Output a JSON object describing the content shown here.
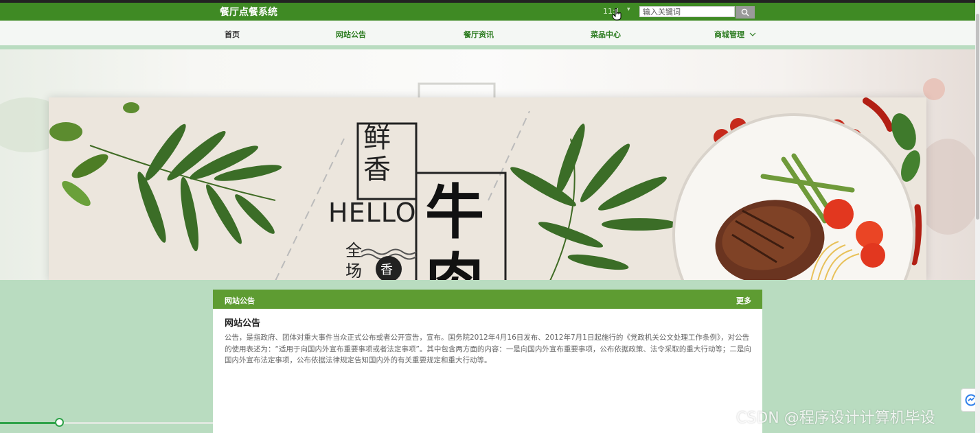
{
  "header": {
    "site_title": "餐厅点餐系统",
    "user_name": "11:1",
    "search_placeholder": "输入关键词"
  },
  "nav": {
    "items": [
      {
        "label": "首页"
      },
      {
        "label": "网站公告"
      },
      {
        "label": "餐厅资讯"
      },
      {
        "label": "菜品中心"
      },
      {
        "label": "商城管理"
      }
    ]
  },
  "banner": {
    "title_vertical": [
      "鲜",
      "香"
    ],
    "hello": "HELLO",
    "big_chars": [
      "牛",
      "肉"
    ],
    "small_vertical": [
      "全",
      "场"
    ],
    "badge": "香"
  },
  "announcement": {
    "panel_title": "网站公告",
    "more_label": "更多",
    "article_title": "网站公告",
    "article_body": "公告，是指政府、团体对重大事件当众正式公布或者公开宣告，宣布。国务院2012年4月16日发布、2012年7月1日起施行的《党政机关公文处理工作条例》，对公告的使用表述为：“适用于向国内外宣布重要事项或者法定事项”。其中包含两方面的内容：一是向国内外宣布重要事项，公布依据政策、法令采取的重大行动等；二是向国内外宣布法定事项，公布依据法律规定告知国内外的有关重要规定和重大行动等。"
  },
  "media": {
    "progress": 0.28
  },
  "watermark": "CSDN @程序设计计算机毕设",
  "colors": {
    "header_green": "#3f8a24",
    "panel_green": "#5e9c32",
    "band_green": "#b9dcc0"
  }
}
